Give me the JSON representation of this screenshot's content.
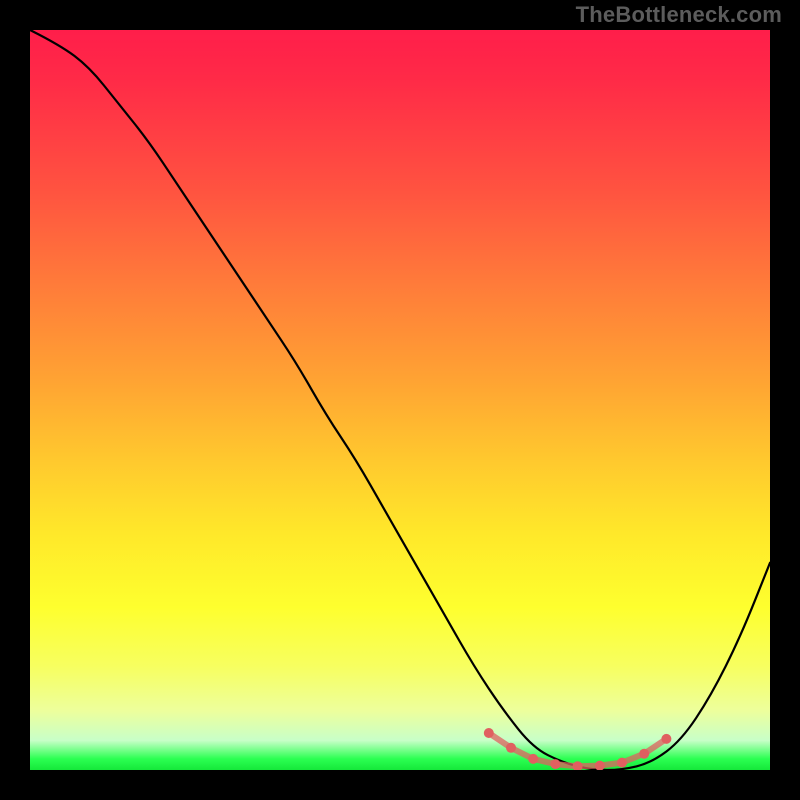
{
  "watermark": "TheBottleneck.com",
  "chart_data": {
    "type": "line",
    "title": "",
    "xlabel": "",
    "ylabel": "",
    "xlim": [
      0,
      100
    ],
    "ylim": [
      0,
      100
    ],
    "grid": false,
    "background_gradient": {
      "top_color": "#ff1e4a",
      "bottom_color": "#15e83a",
      "stops": [
        {
          "pos": 0,
          "color": "#ff1e4a"
        },
        {
          "pos": 22,
          "color": "#ff5440"
        },
        {
          "pos": 47,
          "color": "#ffa233"
        },
        {
          "pos": 78,
          "color": "#feff2e"
        },
        {
          "pos": 96,
          "color": "#c8ffc8"
        },
        {
          "pos": 100,
          "color": "#15e83a"
        }
      ]
    },
    "series": [
      {
        "name": "bottleneck-curve",
        "type": "line",
        "color": "#000000",
        "x": [
          0,
          4,
          8,
          12,
          16,
          20,
          24,
          28,
          32,
          36,
          40,
          44,
          48,
          52,
          56,
          60,
          64,
          68,
          72,
          76,
          80,
          84,
          88,
          92,
          96,
          100
        ],
        "values": [
          100,
          98,
          95,
          90,
          85,
          79,
          73,
          67,
          61,
          55,
          48,
          42,
          35,
          28,
          21,
          14,
          8,
          3,
          1,
          0,
          0,
          1,
          4,
          10,
          18,
          28
        ]
      },
      {
        "name": "optimal-zone-markers",
        "type": "scatter",
        "color": "#e06060",
        "x": [
          62,
          65,
          68,
          71,
          74,
          77,
          80,
          83,
          86
        ],
        "values": [
          5,
          3,
          1.5,
          0.8,
          0.5,
          0.6,
          1.0,
          2.2,
          4.2
        ]
      }
    ],
    "annotations": []
  }
}
